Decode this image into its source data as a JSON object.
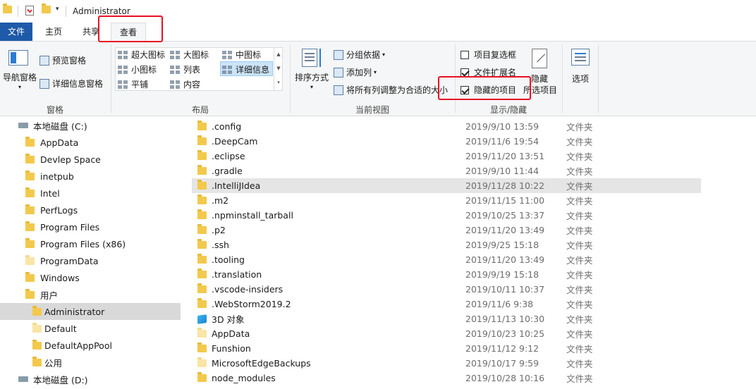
{
  "window": {
    "title": "Administrator"
  },
  "tabs": [
    {
      "label": "文件"
    },
    {
      "label": "主页"
    },
    {
      "label": "共享"
    },
    {
      "label": "查看"
    }
  ],
  "ribbon": {
    "panes": {
      "nav_pane": "导航窗格",
      "preview_pane": "预览窗格",
      "details_pane": "详细信息窗格",
      "group_label": "窗格"
    },
    "layout": {
      "items": [
        "超大图标",
        "大图标",
        "中图标",
        "小图标",
        "列表",
        "详细信息",
        "平铺",
        "内容"
      ],
      "group_label": "布局"
    },
    "current_view": {
      "sort_by": "排序方式",
      "group_by": "分组依据",
      "add_column": "添加列",
      "fit_columns": "将所有列调整为合适的大小",
      "group_label": "当前视图"
    },
    "show_hide": {
      "item_checkboxes": {
        "label": "项目复选框",
        "checked": false
      },
      "file_extensions": {
        "label": "文件扩展名",
        "checked": true
      },
      "hidden_items": {
        "label": "隐藏的项目",
        "checked": true
      },
      "hide_selected_1": "隐藏",
      "hide_selected_2": "所选项目",
      "group_label": "显示/隐藏"
    },
    "options": "选项"
  },
  "nav": {
    "items": [
      {
        "label": "本地磁盘 (C:)",
        "icon": "drive-icon",
        "indent": 1
      },
      {
        "label": "AppData",
        "icon": "folder-icon",
        "indent": 2
      },
      {
        "label": "Devlep Space",
        "icon": "folder-icon",
        "indent": 2
      },
      {
        "label": "inetpub",
        "icon": "folder-icon",
        "indent": 2
      },
      {
        "label": "Intel",
        "icon": "folder-icon",
        "indent": 2
      },
      {
        "label": "PerfLogs",
        "icon": "folder-icon",
        "indent": 2
      },
      {
        "label": "Program Files",
        "icon": "folder-icon",
        "indent": 2
      },
      {
        "label": "Program Files (x86)",
        "icon": "folder-icon",
        "indent": 2
      },
      {
        "label": "ProgramData",
        "icon": "folder-icon-light",
        "indent": 2
      },
      {
        "label": "Windows",
        "icon": "folder-icon",
        "indent": 2
      },
      {
        "label": "用户",
        "icon": "folder-icon",
        "indent": 2
      },
      {
        "label": "Administrator",
        "icon": "folder-icon",
        "indent": 3,
        "selected": true
      },
      {
        "label": "Default",
        "icon": "folder-icon-light",
        "indent": 3
      },
      {
        "label": "DefaultAppPool",
        "icon": "folder-icon",
        "indent": 3
      },
      {
        "label": "公用",
        "icon": "folder-icon",
        "indent": 3
      },
      {
        "label": "本地磁盘 (D:)",
        "icon": "drive-icon",
        "indent": 1
      }
    ]
  },
  "files": [
    {
      "name": ".config",
      "date": "2019/9/10 13:59",
      "type": "文件夹",
      "icon": "folder-icon"
    },
    {
      "name": ".DeepCam",
      "date": "2019/11/6 19:54",
      "type": "文件夹",
      "icon": "folder-icon"
    },
    {
      "name": ".eclipse",
      "date": "2019/11/20 13:51",
      "type": "文件夹",
      "icon": "folder-icon"
    },
    {
      "name": ".gradle",
      "date": "2019/9/10 11:44",
      "type": "文件夹",
      "icon": "folder-icon"
    },
    {
      "name": ".IntelliJIdea",
      "date": "2019/11/28 10:22",
      "type": "文件夹",
      "icon": "folder-icon",
      "highlight": true
    },
    {
      "name": ".m2",
      "date": "2019/11/15 11:00",
      "type": "文件夹",
      "icon": "folder-icon"
    },
    {
      "name": ".npminstall_tarball",
      "date": "2019/10/25 13:37",
      "type": "文件夹",
      "icon": "folder-icon"
    },
    {
      "name": ".p2",
      "date": "2019/11/20 13:49",
      "type": "文件夹",
      "icon": "folder-icon"
    },
    {
      "name": ".ssh",
      "date": "2019/9/25 15:18",
      "type": "文件夹",
      "icon": "folder-icon"
    },
    {
      "name": ".tooling",
      "date": "2019/11/20 13:49",
      "type": "文件夹",
      "icon": "folder-icon"
    },
    {
      "name": ".translation",
      "date": "2019/9/19 15:18",
      "type": "文件夹",
      "icon": "folder-icon"
    },
    {
      "name": ".vscode-insiders",
      "date": "2019/10/11 10:37",
      "type": "文件夹",
      "icon": "folder-icon"
    },
    {
      "name": ".WebStorm2019.2",
      "date": "2019/11/6 9:38",
      "type": "文件夹",
      "icon": "folder-icon"
    },
    {
      "name": "3D 对象",
      "date": "2019/11/13 10:30",
      "type": "文件夹",
      "icon": "3d-objects-icon"
    },
    {
      "name": "AppData",
      "date": "2019/10/23 10:25",
      "type": "文件夹",
      "icon": "folder-icon-light"
    },
    {
      "name": "Funshion",
      "date": "2019/11/12 9:12",
      "type": "文件夹",
      "icon": "folder-icon"
    },
    {
      "name": "MicrosoftEdgeBackups",
      "date": "2019/10/17 9:59",
      "type": "文件夹",
      "icon": "folder-icon-light"
    },
    {
      "name": "node_modules",
      "date": "2019/10/28 10:16",
      "type": "文件夹",
      "icon": "folder-icon"
    }
  ],
  "colors": {
    "file_tab": "#1e5aa8",
    "annotation": "#e81123",
    "selection": "#cce4f7"
  }
}
